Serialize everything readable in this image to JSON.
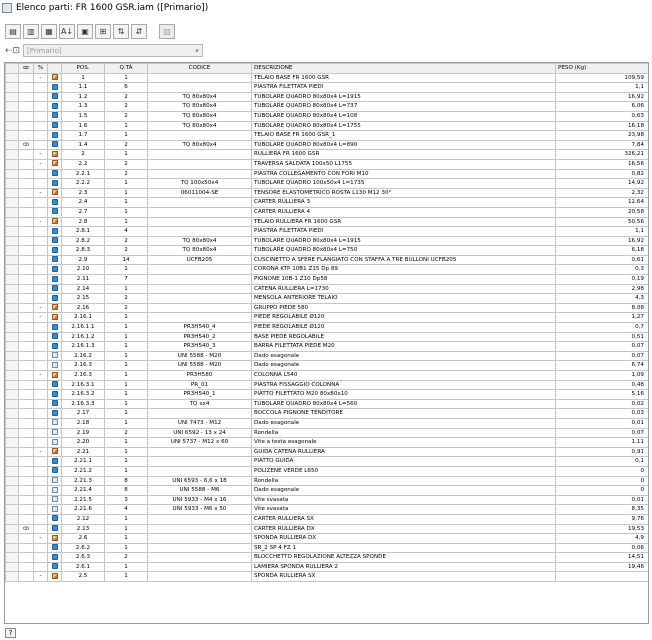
{
  "window": {
    "title": "Elenco parti: FR 1600 GSR.iam ([Primario])"
  },
  "toolbar": {
    "buttons": [
      {
        "name": "tool-button-1",
        "glyph": "▤"
      },
      {
        "name": "tool-button-2",
        "glyph": "▥"
      },
      {
        "name": "tool-button-3",
        "glyph": "▦"
      },
      {
        "name": "sort-button",
        "glyph": "A↓"
      },
      {
        "name": "export-button",
        "glyph": "▣"
      },
      {
        "name": "tool-button-6",
        "glyph": "⊞"
      },
      {
        "name": "tool-button-7",
        "glyph": "⇅"
      },
      {
        "name": "tool-button-8",
        "glyph": "⇵"
      },
      {
        "name": "tool-button-9",
        "glyph": "▨"
      }
    ]
  },
  "representation": {
    "value": "[Primario]"
  },
  "table": {
    "columns": [
      "",
      "POS.",
      "Q.TÀ",
      "CODICE",
      "DESCRIZIONE",
      "PESO (Kg)"
    ],
    "rows": [
      {
        "pos": "1",
        "qty": "1",
        "code": "",
        "desc": "TELAIO BASE FR 1600 GSR",
        "weight": "109,59",
        "icon": "asm",
        "expand": "-",
        "link": ""
      },
      {
        "pos": "1.1",
        "qty": "6",
        "code": "",
        "desc": "PIASTRA FILETTATA PIEDI",
        "weight": "1,1",
        "icon": "part",
        "expand": "",
        "link": ""
      },
      {
        "pos": "1.2",
        "qty": "2",
        "code": "TQ 80x80x4",
        "desc": "TUBOLARE QUADRO 80x80x4 L=1915",
        "weight": "16,92",
        "icon": "part",
        "expand": "",
        "link": ""
      },
      {
        "pos": "1.3",
        "qty": "2",
        "code": "TQ 80x80x4",
        "desc": "TUBOLARE QUADRO 80x80x4 L=737",
        "weight": "6,06",
        "icon": "part",
        "expand": "",
        "link": ""
      },
      {
        "pos": "1.5",
        "qty": "2",
        "code": "TQ 80x80x4",
        "desc": "TUBOLARE QUADRO 80x80x4 L=108",
        "weight": "0,63",
        "icon": "part",
        "expand": "",
        "link": ""
      },
      {
        "pos": "1.6",
        "qty": "1",
        "code": "TQ 80x80x4",
        "desc": "TUBOLARE QUADRO 80x80x4 L=1755",
        "weight": "16,18",
        "icon": "part",
        "expand": "",
        "link": ""
      },
      {
        "pos": "1.7",
        "qty": "1",
        "code": "",
        "desc": "TELAIO BASE FR 1600 GSR_1",
        "weight": "23,98",
        "icon": "part",
        "expand": "",
        "link": ""
      },
      {
        "pos": "1.4",
        "qty": "2",
        "code": "TQ 80x80x4",
        "desc": "TUBOLARE QUADRO 80x80x4 L=890",
        "weight": "7,84",
        "icon": "part",
        "expand": "",
        "link": "ꝏ"
      },
      {
        "pos": "2",
        "qty": "1",
        "code": "",
        "desc": "RULLIERA FR 1600 GSR",
        "weight": "326,21",
        "icon": "asm",
        "expand": "-",
        "link": ""
      },
      {
        "pos": "2.2",
        "qty": "2",
        "code": "",
        "desc": "TRAVERSA SALDATA 100x50 L1755",
        "weight": "16,56",
        "icon": "asm",
        "expand": "-",
        "link": ""
      },
      {
        "pos": "2.2.1",
        "qty": "2",
        "code": "",
        "desc": "PIASTRA COLLEGAMENTO CON FORI M10",
        "weight": "0,82",
        "icon": "part",
        "expand": "",
        "link": ""
      },
      {
        "pos": "2.2.2",
        "qty": "1",
        "code": "TQ 100x50x4",
        "desc": "TUBOLARE QUADRO 100x50x4 L=1735",
        "weight": "14,92",
        "icon": "part",
        "expand": "",
        "link": ""
      },
      {
        "pos": "2.3",
        "qty": "1",
        "code": "06011004-SE",
        "desc": "TENSORE ELASTOMETRICO ROSTA L130 M12 30°",
        "weight": "2,32",
        "icon": "asm",
        "expand": "-",
        "link": ""
      },
      {
        "pos": "2.4",
        "qty": "1",
        "code": "",
        "desc": "CARTER RULLIERA 3",
        "weight": "12,64",
        "icon": "part",
        "expand": "",
        "link": ""
      },
      {
        "pos": "2.7",
        "qty": "1",
        "code": "",
        "desc": "CARTER RULLIERA 4",
        "weight": "20,58",
        "icon": "part",
        "expand": "",
        "link": ""
      },
      {
        "pos": "2.8",
        "qty": "1",
        "code": "",
        "desc": "TELAIO RULLIERA FR 1600 GSR",
        "weight": "50,56",
        "icon": "asm",
        "expand": "-",
        "link": ""
      },
      {
        "pos": "2.8.1",
        "qty": "4",
        "code": "",
        "desc": "PIASTRA FILETTATA PIEDI",
        "weight": "1,1",
        "icon": "part",
        "expand": "",
        "link": ""
      },
      {
        "pos": "2.8.2",
        "qty": "2",
        "code": "TQ 80x80x4",
        "desc": "TUBOLARE QUADRO 80x80x4 L=1915",
        "weight": "16,92",
        "icon": "part",
        "expand": "",
        "link": ""
      },
      {
        "pos": "2.8.3",
        "qty": "2",
        "code": "TQ 80x80x4",
        "desc": "TUBOLARE QUADRO 80x80x4 L=750",
        "weight": "6,18",
        "icon": "part",
        "expand": "",
        "link": ""
      },
      {
        "pos": "2.9",
        "qty": "14",
        "code": "UCFB205",
        "desc": "CUSCINETTO A SFERE FLANGIATO CON STAFFA A TRE BULLONI UCFB205",
        "weight": "0,61",
        "icon": "part",
        "expand": "",
        "link": ""
      },
      {
        "pos": "2.10",
        "qty": "1",
        "code": "",
        "desc": "CORONA KTP 10B1 Z15 Dp 89",
        "weight": "0,3",
        "icon": "part",
        "expand": "",
        "link": ""
      },
      {
        "pos": "2.11",
        "qty": "7",
        "code": "",
        "desc": "PIGNONE 10B-1 Z10 Dp58",
        "weight": "0,19",
        "icon": "part",
        "expand": "",
        "link": ""
      },
      {
        "pos": "2.14",
        "qty": "1",
        "code": "",
        "desc": "CATENA RULLIERA L=1730",
        "weight": "2,98",
        "icon": "part",
        "expand": "",
        "link": ""
      },
      {
        "pos": "2.15",
        "qty": "2",
        "code": "",
        "desc": "MENSOLA ANTERIORE TELAIO",
        "weight": "4,3",
        "icon": "part",
        "expand": "",
        "link": ""
      },
      {
        "pos": "2.16",
        "qty": "2",
        "code": "",
        "desc": "GRUPPO PIEDE 580",
        "weight": "8,08",
        "icon": "asm",
        "expand": "-",
        "link": ""
      },
      {
        "pos": "2.16.1",
        "qty": "1",
        "code": "",
        "desc": "PIEDE REGOLABILE Ø120",
        "weight": "1,27",
        "icon": "asm",
        "expand": "-",
        "link": ""
      },
      {
        "pos": "2.16.1.1",
        "qty": "1",
        "code": "PR3H540_4",
        "desc": "PIEDE REGOLABILE Ø120",
        "weight": "0,7",
        "icon": "part",
        "expand": "",
        "link": ""
      },
      {
        "pos": "2.16.1.2",
        "qty": "1",
        "code": "PR3H540_2",
        "desc": "BASE PIEDE REGOLABILE",
        "weight": "0,51",
        "icon": "part",
        "expand": "",
        "link": ""
      },
      {
        "pos": "2.16.1.3",
        "qty": "1",
        "code": "PR3H540_3",
        "desc": "BARRA FILETTATA PIEDE M20",
        "weight": "0,07",
        "icon": "part",
        "expand": "",
        "link": ""
      },
      {
        "pos": "2.16.2",
        "qty": "1",
        "code": "UNI 5588 - M20",
        "desc": "Dado esagonale",
        "weight": "0,07",
        "icon": "std",
        "expand": "",
        "link": ""
      },
      {
        "pos": "2.16.3",
        "qty": "1",
        "code": "UNI 5588 - M20",
        "desc": "Dado esagonale",
        "weight": "6,74",
        "icon": "std",
        "expand": "",
        "link": ""
      },
      {
        "pos": "2.16.3",
        "qty": "1",
        "code": "PR3H580",
        "desc": "COLONNA L540",
        "weight": "1,09",
        "icon": "asm",
        "expand": "-",
        "link": ""
      },
      {
        "pos": "2.16.3.1",
        "qty": "1",
        "code": "PR_01",
        "desc": "PIASTRA FISSAGGIO COLONNA",
        "weight": "0,48",
        "icon": "part",
        "expand": "",
        "link": ""
      },
      {
        "pos": "2.16.3.2",
        "qty": "1",
        "code": "PR3H540_1",
        "desc": "PIATTO FILETTATO M20 80x80x10",
        "weight": "5,16",
        "icon": "part",
        "expand": "",
        "link": ""
      },
      {
        "pos": "2.16.3.3",
        "qty": "1",
        "code": "TQ xx4",
        "desc": "TUBOLARE QUADRO 80x80x4 L=560",
        "weight": "0,02",
        "icon": "part",
        "expand": "",
        "link": ""
      },
      {
        "pos": "2.17",
        "qty": "1",
        "code": "",
        "desc": "BOCCOLA PIGNONE TENDITORE",
        "weight": "0,03",
        "icon": "part",
        "expand": "",
        "link": ""
      },
      {
        "pos": "2.18",
        "qty": "1",
        "code": "UNI 7473 - M12",
        "desc": "Dado esagonale",
        "weight": "0,01",
        "icon": "std",
        "expand": "",
        "link": ""
      },
      {
        "pos": "2.19",
        "qty": "2",
        "code": "UNI 6592 - 13 x 24",
        "desc": "Rondella",
        "weight": "0,07",
        "icon": "std",
        "expand": "",
        "link": ""
      },
      {
        "pos": "2.20",
        "qty": "1",
        "code": "UNI 5737 - M12 x 60",
        "desc": "Vite a testa esagonale",
        "weight": "1,11",
        "icon": "std",
        "expand": "",
        "link": ""
      },
      {
        "pos": "2.21",
        "qty": "1",
        "code": "",
        "desc": "GUIDA CATENA RULLIERA",
        "weight": "0,91",
        "icon": "asm",
        "expand": "-",
        "link": ""
      },
      {
        "pos": "2.21.1",
        "qty": "1",
        "code": "",
        "desc": "PIATTO GUIDA",
        "weight": "0,1",
        "icon": "part",
        "expand": "",
        "link": ""
      },
      {
        "pos": "2.21.2",
        "qty": "1",
        "code": "",
        "desc": "POLIZENE VERDE L650",
        "weight": "0",
        "icon": "part",
        "expand": "",
        "link": ""
      },
      {
        "pos": "2.21.3",
        "qty": "8",
        "code": "UNI 6593 - 6,6 x 18",
        "desc": "Rondella",
        "weight": "0",
        "icon": "std",
        "expand": "",
        "link": ""
      },
      {
        "pos": "2.21.4",
        "qty": "8",
        "code": "UNI 5588 - M6",
        "desc": "Dado esagonale",
        "weight": "0",
        "icon": "std",
        "expand": "",
        "link": ""
      },
      {
        "pos": "2.21.5",
        "qty": "3",
        "code": "UNI 5933 - M4 x 16",
        "desc": "Vite svasata",
        "weight": "0,01",
        "icon": "std",
        "expand": "",
        "link": ""
      },
      {
        "pos": "2.21.6",
        "qty": "4",
        "code": "UNI 5933 - M6 x 50",
        "desc": "Vite svasata",
        "weight": "8,35",
        "icon": "std",
        "expand": "",
        "link": ""
      },
      {
        "pos": "2.12",
        "qty": "1",
        "code": "",
        "desc": "CARTER RULLIERA SX",
        "weight": "9,76",
        "icon": "part",
        "expand": "",
        "link": ""
      },
      {
        "pos": "2.13",
        "qty": "1",
        "code": "",
        "desc": "CARTER RULLIERA DX",
        "weight": "19,53",
        "icon": "part",
        "expand": "",
        "link": "ꝏ"
      },
      {
        "pos": "2.6",
        "qty": "1",
        "code": "",
        "desc": "SPONDA RULLIERA DX",
        "weight": "4,9",
        "icon": "asm",
        "expand": "-",
        "link": ""
      },
      {
        "pos": "2.6.2",
        "qty": "1",
        "code": "",
        "desc": "SR_2 SP 4 FZ 1",
        "weight": "0,06",
        "icon": "part",
        "expand": "",
        "link": ""
      },
      {
        "pos": "2.6.3",
        "qty": "2",
        "code": "",
        "desc": "BLOCCHETTO REGOLAZIONE ALTEZZA SPONDE",
        "weight": "14,51",
        "icon": "part",
        "expand": "",
        "link": ""
      },
      {
        "pos": "2.6.1",
        "qty": "1",
        "code": "",
        "desc": "LAMIERA SPONDA RULLIERA 2",
        "weight": "19,46",
        "icon": "part",
        "expand": "",
        "link": ""
      },
      {
        "pos": "2.5",
        "qty": "1",
        "code": "",
        "desc": "SPONDA RULLIERA SX",
        "weight": "",
        "icon": "asm",
        "expand": "-",
        "link": ""
      }
    ]
  },
  "statusbar": {
    "help_glyph": "?"
  }
}
